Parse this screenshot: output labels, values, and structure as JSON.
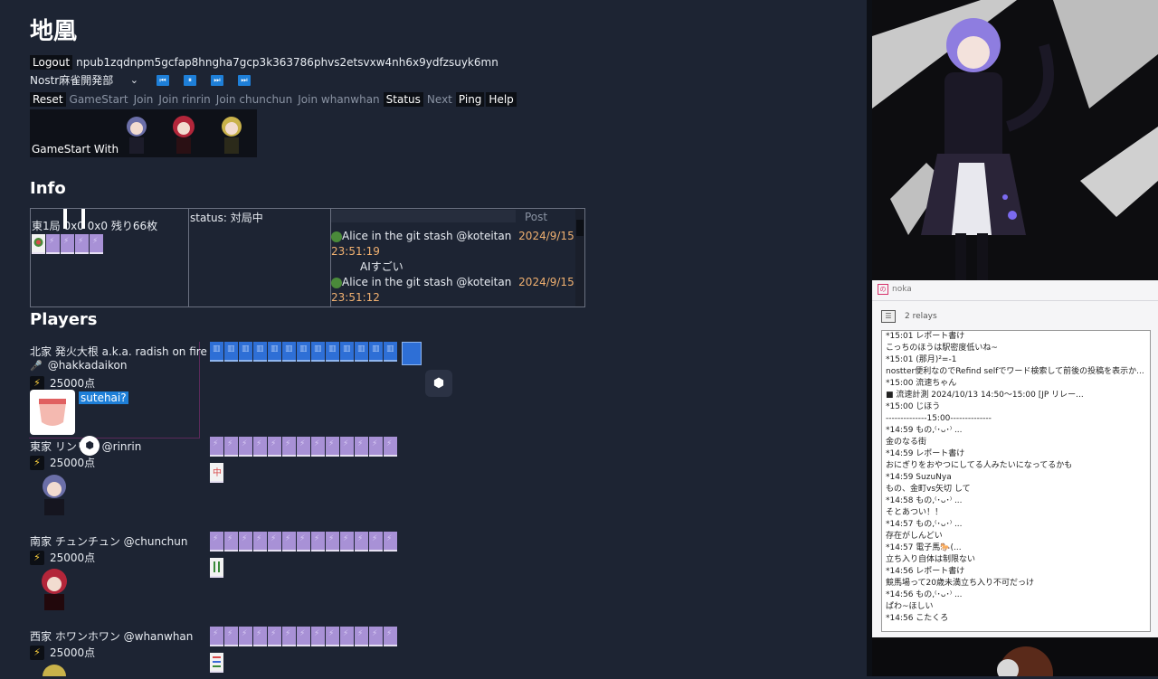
{
  "app": {
    "title": "地凰",
    "logout_label": "Logout",
    "npub": "npub1zqdnpm5gcfap8hngha7gcp3k363786phvs2etsvxw4nh6x9ydfzsuyk6mn",
    "relay_select": "Nostr麻雀開発部",
    "chevron": "⌄",
    "controls": [
      "⏮",
      "⏸",
      "⏭",
      "⏭"
    ],
    "buttons": [
      {
        "label": "Reset",
        "style": "dark"
      },
      {
        "label": "GameStart",
        "style": "muted"
      },
      {
        "label": "Join",
        "style": "muted"
      },
      {
        "label": "Join rinrin",
        "style": "muted"
      },
      {
        "label": "Join chunchun",
        "style": "muted"
      },
      {
        "label": "Join whanwhan",
        "style": "muted"
      },
      {
        "label": "Status",
        "style": "dark"
      },
      {
        "label": "Next",
        "style": "muted"
      },
      {
        "label": "Ping",
        "style": "dark"
      },
      {
        "label": "Help",
        "style": "dark"
      }
    ],
    "gamestart_with": "GameStart With"
  },
  "info": {
    "heading": "Info",
    "round": "東1局 0x0 0x0 残り66枚",
    "status": "status: 対局中",
    "post_label": "Post",
    "messages": [
      {
        "author": "Alice in the git stash @koteitan",
        "date": "2024/9/15",
        "time": "23:51:19",
        "body": "AIすごい"
      },
      {
        "author": "Alice in the git stash @koteitan",
        "date": "2024/9/15",
        "time": "23:51:12",
        "body": ""
      }
    ]
  },
  "players": {
    "heading": "Players",
    "list": [
      {
        "name": "北家 発火大根 a.k.a. radish on fire",
        "handle": "@hakkadaikon",
        "handle_icon": "🎤",
        "points": "25000点",
        "prompt": "sutehai?"
      },
      {
        "name": "東家 リンリン @rinrin",
        "points": "25000点"
      },
      {
        "name": "南家 チュンチュン @chunchun",
        "points": "25000点"
      },
      {
        "name": "西家 ホワンホワン @whanwhan",
        "points": "25000点"
      }
    ]
  },
  "noka": {
    "title": "noka",
    "relays": "2 relays",
    "feed": [
      "*15:01 レポート書け",
      " こっちのほうは駅密度低いね~",
      "*15:01 (那月)²=-1",
      " nostter便利なのでRefind selfでワード検索して前後の投稿を表示か...",
      "*15:00 流速ちゃん",
      " ■ 流速計測   2024/10/13 14:50～15:00  [JP リレー...",
      "*15:00 じほう",
      "  --------------15:00--------------",
      "*14:59 もの,⁽･ᴗ･⁾ ...",
      " 金のなる街",
      "*14:59 レポート書け",
      " おにぎりをおやつにしてる人みたいになってるかも",
      "*14:59 SuzuNya",
      " もの、金町vs矢切 して",
      "*14:58 もの,⁽･ᴗ･⁾ ...",
      " そとあつい！！",
      "*14:57 もの,⁽･ᴗ･⁾ ...",
      " 存在がしんどい",
      "*14:57 電子馬🐎(...",
      " 立ち入り自体は制限ない",
      "*14:56 レポート書け",
      " 競馬場って20歳未満立ち入り不可だっけ",
      "*14:56 もの,⁽･ᴗ･⁾ ...",
      " ぱわ~ほしい",
      "*14:56 こたくろ"
    ]
  },
  "colors": {
    "background": "#1d2433",
    "tile_purple": "#a891d6",
    "tile_blue": "#2e6fd6",
    "date_orange": "#f0b070",
    "noka_accent": "#d6306a"
  }
}
